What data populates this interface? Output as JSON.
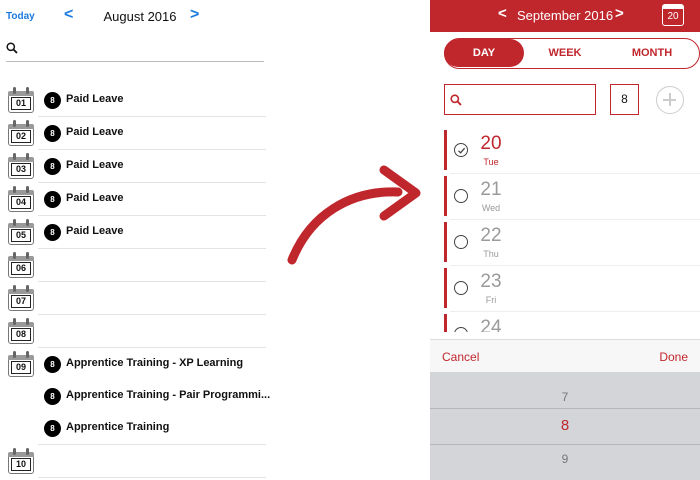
{
  "left": {
    "today_label": "Today",
    "prev_glyph": "<",
    "next_glyph": ">",
    "month_title": "August 2016",
    "search_icon": "search-icon",
    "days": [
      {
        "day": "01",
        "events": [
          {
            "badge": "8",
            "title": "Paid Leave"
          }
        ]
      },
      {
        "day": "02",
        "events": [
          {
            "badge": "8",
            "title": "Paid Leave"
          }
        ]
      },
      {
        "day": "03",
        "events": [
          {
            "badge": "8",
            "title": "Paid Leave"
          }
        ]
      },
      {
        "day": "04",
        "events": [
          {
            "badge": "8",
            "title": "Paid Leave"
          }
        ]
      },
      {
        "day": "05",
        "events": [
          {
            "badge": "8",
            "title": "Paid Leave"
          }
        ]
      },
      {
        "day": "06",
        "events": []
      },
      {
        "day": "07",
        "events": []
      },
      {
        "day": "08",
        "events": []
      },
      {
        "day": "09",
        "events": [
          {
            "badge": "8",
            "title": "Apprentice Training - XP Learning"
          },
          {
            "badge": "8",
            "title": "Apprentice Training - Pair Programmi..."
          },
          {
            "badge": "8",
            "title": "Apprentice Training"
          }
        ]
      },
      {
        "day": "10",
        "events": []
      }
    ]
  },
  "right": {
    "prev_glyph": "<",
    "next_glyph": ">",
    "month_title": "September 2016",
    "calendar_day": "20",
    "tabs": [
      {
        "label": "DAY",
        "active": true
      },
      {
        "label": "WEEK",
        "active": false
      },
      {
        "label": "MONTH",
        "active": false
      }
    ],
    "search_placeholder": "",
    "count_value": "8",
    "days": [
      {
        "num": "20",
        "weekday": "Tue",
        "selected": true,
        "checked": true
      },
      {
        "num": "21",
        "weekday": "Wed",
        "selected": false,
        "checked": false
      },
      {
        "num": "22",
        "weekday": "Thu",
        "selected": false,
        "checked": false
      },
      {
        "num": "23",
        "weekday": "Fri",
        "selected": false,
        "checked": false
      },
      {
        "num": "24",
        "weekday": "",
        "selected": false,
        "checked": false
      }
    ],
    "picker": {
      "cancel_label": "Cancel",
      "done_label": "Done",
      "options": [
        "7",
        "8",
        "9"
      ],
      "selected_index": 1
    }
  },
  "colors": {
    "accent_red": "#c0272d",
    "link_blue": "#1a7ae0"
  }
}
